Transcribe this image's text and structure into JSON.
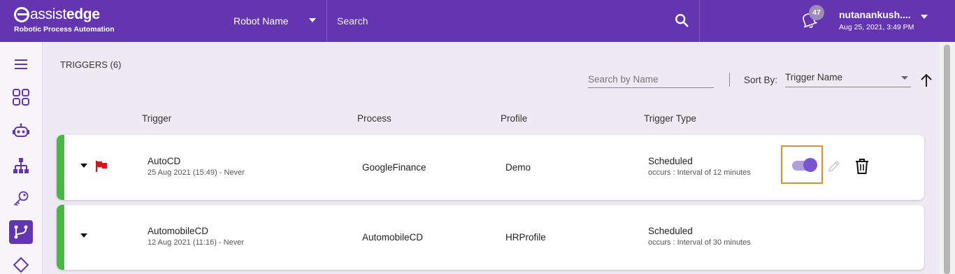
{
  "header": {
    "logo_light": "assist",
    "logo_bold": "edge",
    "logo_sub": "Robotic Process Automation",
    "robot_select": "Robot Name",
    "search_placeholder": "Search",
    "notification_count": "47",
    "user_name": "nutanankush....",
    "user_date": "Aug 25, 2021, 3:49 PM"
  },
  "sidebar": {
    "items": [
      {
        "icon": "menu-icon"
      },
      {
        "icon": "dashboard-icon"
      },
      {
        "icon": "robot-icon"
      },
      {
        "icon": "hierarchy-icon"
      },
      {
        "icon": "key-icon"
      },
      {
        "icon": "triggers-icon",
        "active": true
      },
      {
        "icon": "chip-icon"
      }
    ]
  },
  "main": {
    "title": "TRIGGERS (6)",
    "search_placeholder": "Search by Name",
    "sort_label": "Sort By:",
    "sort_value": "Trigger Name",
    "columns": [
      "Trigger",
      "Process",
      "Profile",
      "Trigger Type"
    ],
    "rows": [
      {
        "name": "AutoCD",
        "schedule": "25 Aug 2021 (15:49) - Never",
        "process": "GoogleFinance",
        "profile": "Demo",
        "type": "Scheduled",
        "occurs": "occurs : Interval of 12 minutes",
        "flagged": true,
        "toggle_on": true
      },
      {
        "name": "AutomobileCD",
        "schedule": "12 Aug 2021 (11:16) - Never",
        "process": "AutomobileCD",
        "profile": "HRProfile",
        "type": "Scheduled",
        "occurs": "occurs : Interval of 30 minutes",
        "flagged": false,
        "toggle_on": false
      }
    ]
  },
  "colors": {
    "header": "#6435b0",
    "status_bar": "#48b843",
    "flag": "#e01010",
    "toggle": "#7b54cf",
    "highlight": "#e08a3c"
  }
}
